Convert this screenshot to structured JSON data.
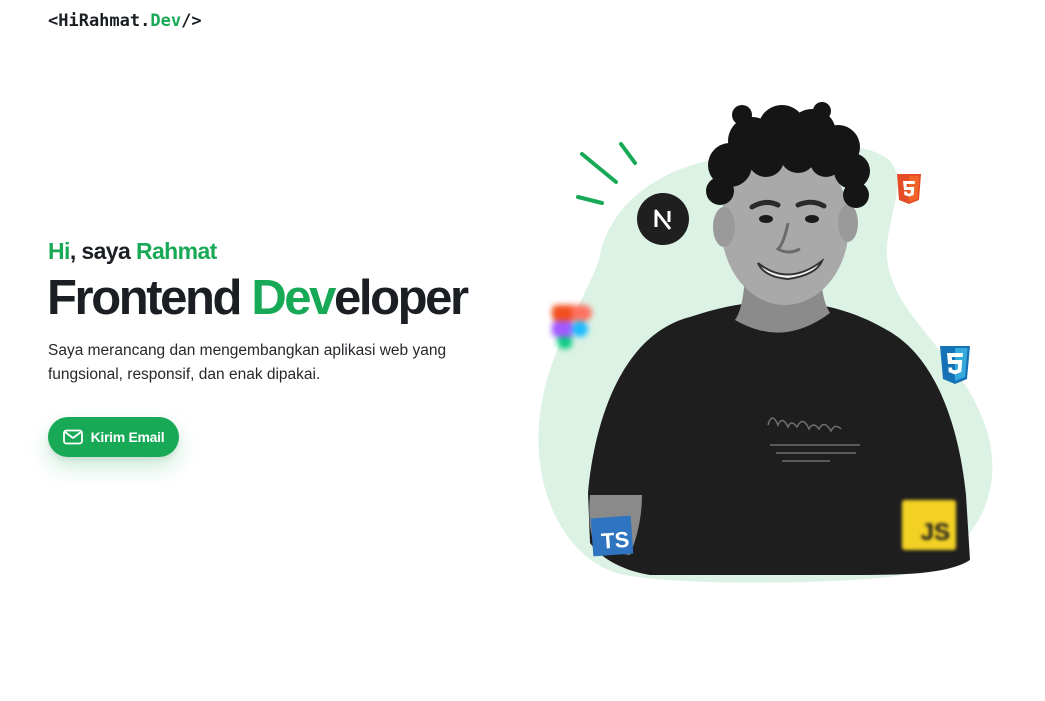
{
  "header": {
    "logo_prefix": "<HiRahmat.",
    "logo_accent": "Dev",
    "logo_suffix": "/>"
  },
  "hero": {
    "greeting_hi": "Hi",
    "greeting_middle": ", saya ",
    "greeting_name": "Rahmat",
    "title_part1": "Frontend ",
    "title_accent": "Dev",
    "title_part2": "eloper",
    "description": "Saya merancang dan mengembangkan aplikasi web yang fungsional, responsif, dan enak dipakai.",
    "cta_label": "Kirim Email",
    "cta_icon": "mail-icon"
  },
  "tech_icons": {
    "next": "N",
    "typescript": "TS",
    "javascript": "JS",
    "html_icon": "html5-icon",
    "css_icon": "css3-icon",
    "figma_icon": "figma-icon"
  },
  "colors": {
    "accent": "#18a957",
    "blob": "#dcf2e4",
    "text": "#1b1f23",
    "html5": "#e44d26",
    "css3": "#1572b6",
    "typescript": "#2f74c0",
    "javascript": "#f2d024"
  }
}
